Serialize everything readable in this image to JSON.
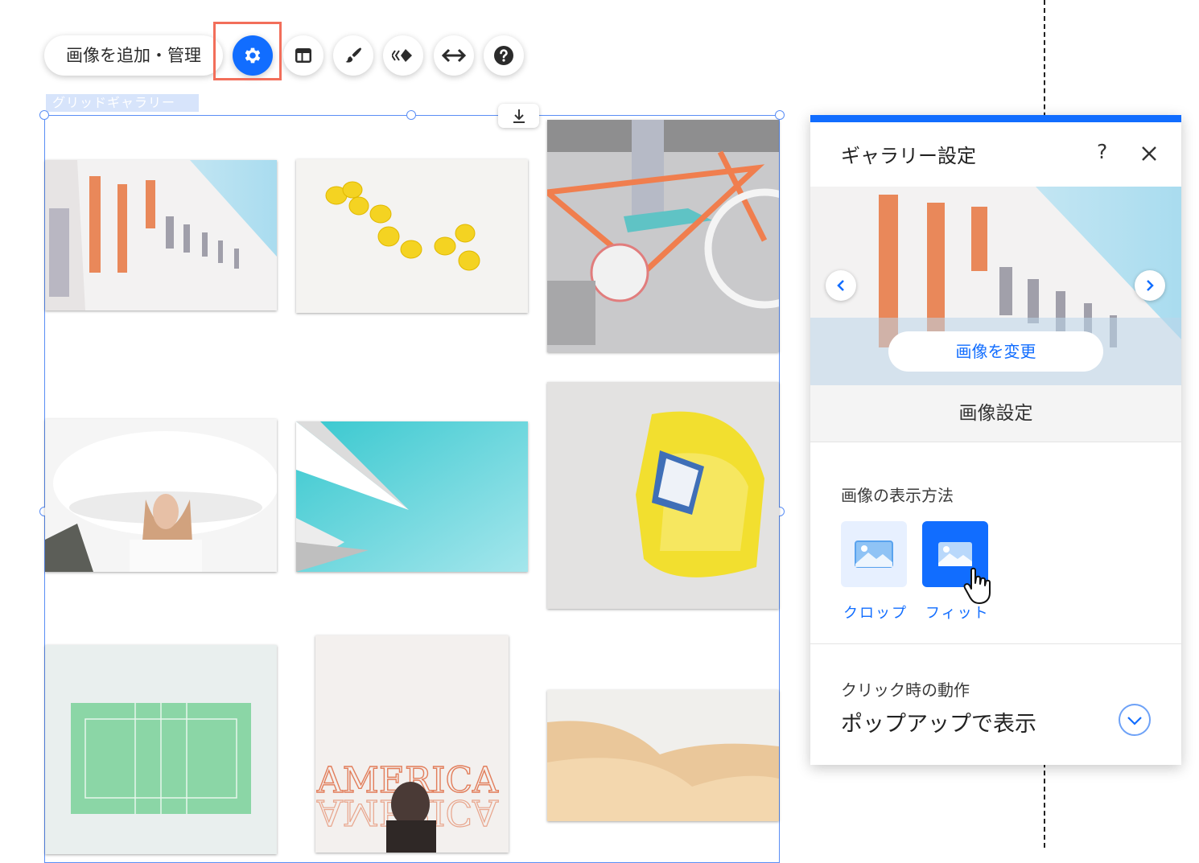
{
  "toolbar": {
    "manage_label": "画像を追加・管理",
    "buttons": [
      "settings-icon",
      "layout-icon",
      "design-brush-icon",
      "animation-icon",
      "stretch-icon",
      "help-icon"
    ],
    "highlight_color": "#f26e5a"
  },
  "gallery": {
    "tag": "グリッドギャラリー",
    "images": [
      "building-photo",
      "lemons-photo",
      "bicycle-photo",
      "woman-hat-photo",
      "architecture-photo",
      "yellow-chair-photo",
      "tennis-court-photo",
      "america-sign-photo",
      "desert-photo"
    ]
  },
  "panel": {
    "title": "ギャラリー設定",
    "help": "?",
    "change_image": "画像を変更",
    "section_title": "画像設定",
    "display_label": "画像の表示方法",
    "options": {
      "crop": "クロップ",
      "fit": "フィット",
      "selected": "fit"
    },
    "click_label": "クリック時の動作",
    "click_value": "ポップアップで表示",
    "accent": "#116dff"
  }
}
